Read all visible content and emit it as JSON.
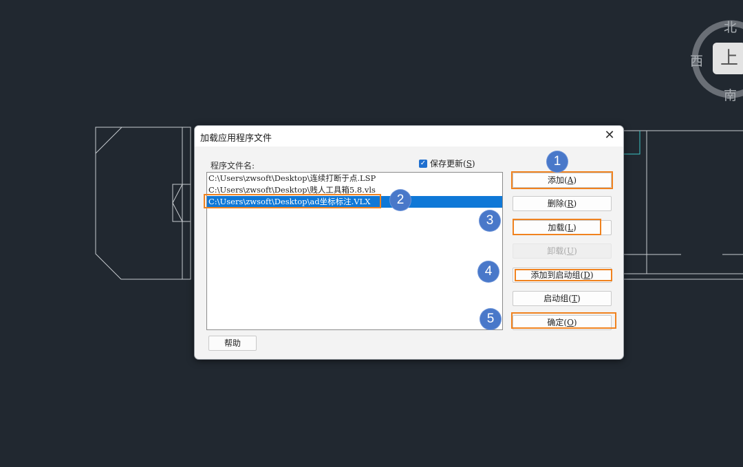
{
  "compass": {
    "north": "北",
    "west": "西",
    "south": "南",
    "top_face": "上"
  },
  "dialog": {
    "title": "加载应用程序文件",
    "close": "✕",
    "files_label": "程序文件名:",
    "save_updates": {
      "checked": true,
      "label": "保存更新(",
      "key": "S",
      "suffix": ")"
    },
    "files": [
      "C:\\Users\\zwsoft\\Desktop\\连续打断于点.LSP",
      "C:\\Users\\zwsoft\\Desktop\\贱人工具箱5.8.vls",
      "C:\\Users\\zwsoft\\Desktop\\ad坐标标注.VLX"
    ],
    "selected_index": 2,
    "buttons": {
      "add": {
        "text": "添加(",
        "key": "A",
        "suffix": ")"
      },
      "remove": {
        "text": "删除(",
        "key": "R",
        "suffix": ")"
      },
      "load": {
        "text": "加载(",
        "key": "L",
        "suffix": ")"
      },
      "unload": {
        "text": "卸载(",
        "key": "U",
        "suffix": ")"
      },
      "add_startup": {
        "text": "添加到启动组(",
        "key": "D",
        "suffix": ")"
      },
      "startup": {
        "text": "启动组(",
        "key": "T",
        "suffix": ")"
      },
      "ok": {
        "text": "确定(",
        "key": "O",
        "suffix": ")"
      }
    },
    "help": "帮助"
  },
  "markers": [
    "1",
    "2",
    "3",
    "4",
    "5"
  ],
  "colors": {
    "highlight": "#f0821e",
    "marker": "#4978c9",
    "selection": "#0f78d7"
  }
}
